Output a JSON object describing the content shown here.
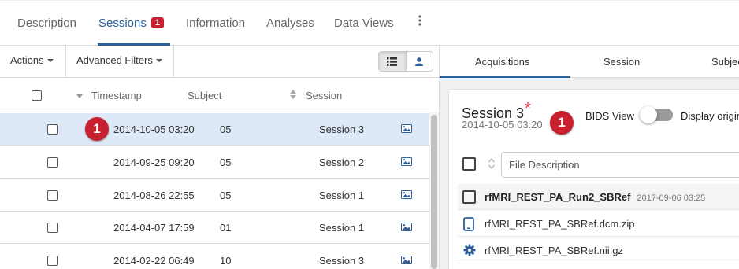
{
  "top_tabs": [
    {
      "label": "Description"
    },
    {
      "label": "Sessions",
      "badge": "1"
    },
    {
      "label": "Information"
    },
    {
      "label": "Analyses"
    },
    {
      "label": "Data Views"
    }
  ],
  "kebab_icon": "more-vert-icon",
  "toolbar": {
    "actions_label": "Actions",
    "advanced_filters_label": "Advanced Filters",
    "view_icons": [
      "list-view-icon",
      "subject-view-icon"
    ]
  },
  "table": {
    "columns": {
      "timestamp": "Timestamp",
      "subject": "Subject",
      "session": "Session"
    },
    "rows": [
      {
        "timestamp": "2014-10-05 03:20",
        "subject": "05",
        "session": "Session 3",
        "selected": true,
        "badge": "1"
      },
      {
        "timestamp": "2014-09-25 09:20",
        "subject": "05",
        "session": "Session 2"
      },
      {
        "timestamp": "2014-08-26 22:55",
        "subject": "05",
        "session": "Session 1"
      },
      {
        "timestamp": "2014-04-07 17:59",
        "subject": "01",
        "session": "Session 1"
      },
      {
        "timestamp": "2014-02-22 06:49",
        "subject": "10",
        "session": "Session 3"
      }
    ],
    "row_icon": "image-icon"
  },
  "right_panel": {
    "tabs": [
      {
        "label": "Acquisitions"
      },
      {
        "label": "Session"
      },
      {
        "label": "Subject"
      }
    ],
    "card": {
      "title": "Session 3",
      "required_marker": "*",
      "date": "2014-10-05 03:20",
      "badge": "1",
      "bids_label": "BIDS View",
      "display_original_label": "Display original",
      "file_description_placeholder": "File Description",
      "acquisition": {
        "name": "rfMRI_REST_PA_Run2_SBRef",
        "date": "2017-09-06 03:25"
      },
      "files": [
        {
          "name": "rfMRI_REST_PA_SBRef.dcm.zip",
          "icon": "dicom-file-icon"
        },
        {
          "name": "rfMRI_REST_PA_SBRef.nii.gz",
          "icon": "gear-icon"
        }
      ]
    }
  },
  "colors": {
    "accent": "#2d5f9a",
    "badge": "#c9202f",
    "selected_row": "#dde9f7"
  }
}
